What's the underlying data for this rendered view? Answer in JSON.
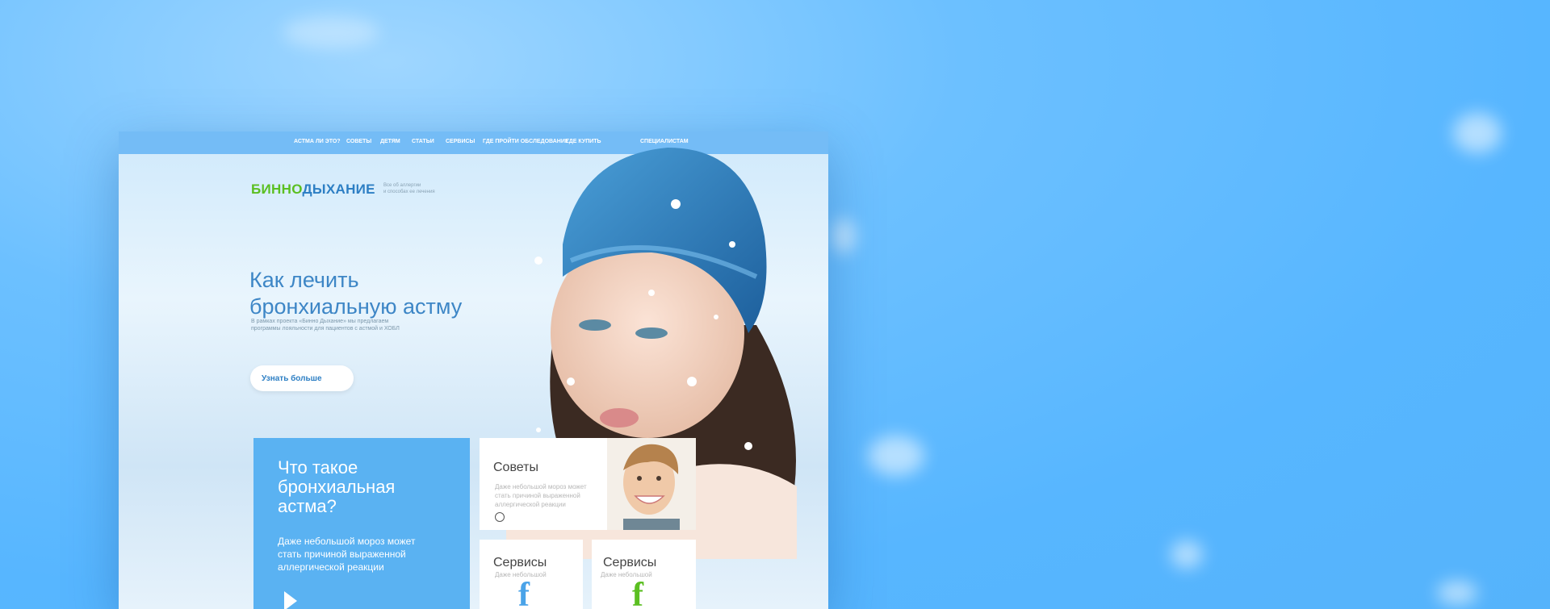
{
  "nav": {
    "items": [
      "АСТМА ЛИ ЭТО?",
      "СОВЕТЫ",
      "ДЕТЯМ",
      "СТАТЬИ",
      "СЕРВИСЫ",
      "ГДЕ ПРОЙТИ ОБСЛЕДОВАНИЕ",
      "ГДЕ КУПИТЬ",
      "СПЕЦИАЛИСТАМ"
    ]
  },
  "logo": {
    "part1": "БИННО",
    "part2": "ДЫХАНИЕ"
  },
  "tagline": {
    "line1": "Все об аллергии",
    "line2": "и способах ее лечения"
  },
  "hero": {
    "title_line1": "Как лечить",
    "title_line2": "бронхиальную астму",
    "intro_line1": "В рамках проекта «Бинно Дыхание» мы предлагаем",
    "intro_line2": "программы лояльности для пациентов с астмой и ХОБЛ",
    "cta": "Узнать больше"
  },
  "blue_card": {
    "title": "Что такое бронхиальная астма?",
    "text": "Даже небольшой мороз может стать причиной выраженной аллергической реакции"
  },
  "tips_card": {
    "title": "Советы",
    "text": "Даже небольшой мороз может стать причиной выраженной аллергической реакции"
  },
  "service_card_1": {
    "title": "Сервисы",
    "text": "Даже небольшой",
    "icon": "f"
  },
  "service_card_2": {
    "title": "Сервисы",
    "text": "Даже небольшой",
    "icon": "f"
  },
  "colors": {
    "background": "#57b6ff",
    "logo_green": "#5bbf21",
    "logo_blue": "#2d7fc4",
    "card_blue": "#5ab2f2",
    "facebook_blue": "#4aa3e8",
    "facebook_green": "#5bbf21"
  }
}
